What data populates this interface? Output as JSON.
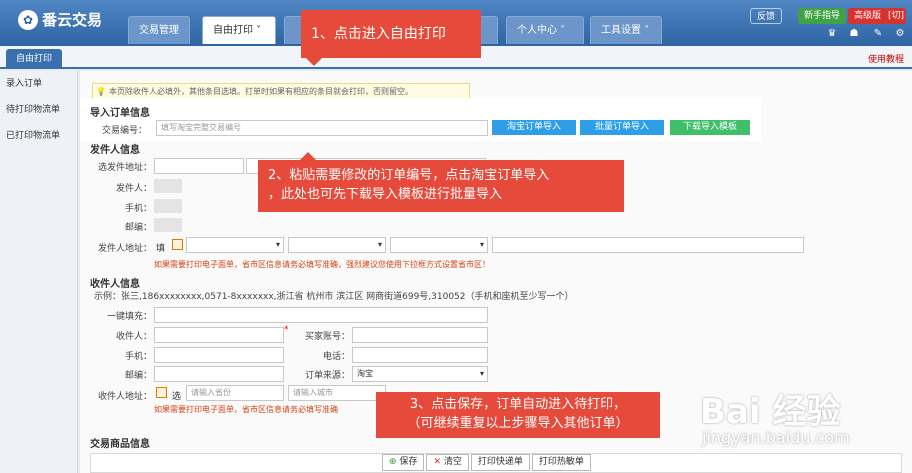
{
  "app": {
    "name": "番云交易"
  },
  "nav": {
    "tabs": [
      "交易管理",
      "自由打印",
      "",
      "",
      "个人中心",
      "工具设置"
    ],
    "active": 1
  },
  "header": {
    "feedback": "反馈",
    "guide": "新手指导",
    "version": "高级版",
    "switch": "[切]"
  },
  "subbar": {
    "tab": "自由打印",
    "help": "使用教程"
  },
  "sidebar": {
    "items": [
      "录入订单",
      "待打印物流单",
      "已打印物流单"
    ]
  },
  "notice": "本页除收件人必填外，其他条目选填。打单时如果有相应的条目就会打印，否则留空。",
  "import": {
    "title": "导入订单信息",
    "label": "交易编号：",
    "placeholder": "填写淘宝完整交易编号",
    "btn_taobao": "淘宝订单导入",
    "btn_batch": "批量订单导入",
    "btn_template": "下载导入模板"
  },
  "sender": {
    "title": "发件人信息",
    "select_label": "选发件地址：",
    "name_label": "发件人：",
    "phone_label": "手机：",
    "zip_label": "邮编：",
    "addr_label": "发件人地址：",
    "addr_fill": "填",
    "warn": "如果需要打印电子面单，省市区信息请务必填写准确，强烈建议您使用下拉框方式设置省市区！"
  },
  "receiver": {
    "title": "收件人信息",
    "example": "示例：张三,186xxxxxxxx,0571-8xxxxxxx,浙江省 杭州市 滨江区 网商街道699号,310052（手机和座机至少写一个）",
    "quickfill_label": "一键填充：",
    "name_label": "收件人：",
    "buyer_label": "买家账号：",
    "mobile_label": "手机：",
    "phone_label": "电话：",
    "zip_label": "邮编：",
    "source_label": "订单来源：",
    "source_value": "淘宝",
    "addr_label": "收件人地址：",
    "addr_fill": "选",
    "province_ph": "请输入省份",
    "city_ph": "请输入城市",
    "warn": "如果需要打印电子面单，省市区信息请务必填写准确"
  },
  "goods": {
    "title": "交易商品信息"
  },
  "bottom": {
    "save": "保存",
    "clear": "清空",
    "print_express": "打印快递单",
    "print_thermal": "打印热敏单"
  },
  "callouts": {
    "step1": "1、点击进入自由打印",
    "step2_line1": "2、粘贴需要修改的订单编号，点击淘宝订单导入",
    "step2_line2": "，此处也可先下载导入模板进行批量导入",
    "step3_line1": "3、点击保存，订单自动进入待打印，",
    "step3_line2": "（可继续重复以上步骤导入其他订单）"
  },
  "watermark": {
    "brand": "Bai 经验",
    "url": "jingyan.baidu.com"
  },
  "colors": {
    "callout": "#e64a3b",
    "button_blue": "#2e9ee6",
    "button_green": "#3fbf6a",
    "warn": "#d84315"
  }
}
